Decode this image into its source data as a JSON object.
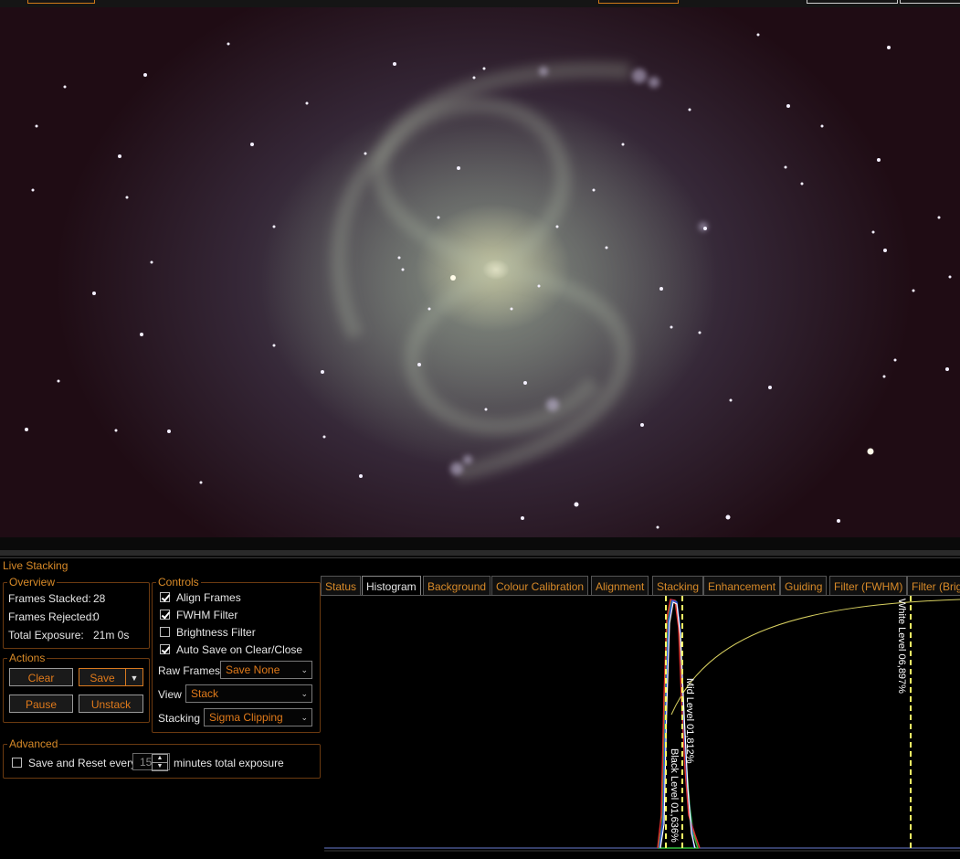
{
  "window": {
    "panel_title": "Live Stacking"
  },
  "overview": {
    "legend": "Overview",
    "frames_stacked_label": "Frames Stacked:",
    "frames_stacked_value": "28",
    "frames_rejected_label": "Frames Rejected:",
    "frames_rejected_value": "0",
    "total_exposure_label": "Total Exposure:",
    "total_exposure_value": "21m 0s"
  },
  "actions": {
    "legend": "Actions",
    "clear": "Clear",
    "save": "Save",
    "pause": "Pause",
    "unstack": "Unstack"
  },
  "controls": {
    "legend": "Controls",
    "align_frames": {
      "label": "Align Frames",
      "checked": true
    },
    "fwhm_filter": {
      "label": "FWHM Filter",
      "checked": true
    },
    "brightness_filter": {
      "label": "Brightness Filter",
      "checked": false
    },
    "auto_save": {
      "label": "Auto Save on Clear/Close",
      "checked": true
    },
    "raw_frames_label": "Raw Frames",
    "raw_frames_value": "Save None",
    "view_label": "View",
    "view_value": "Stack",
    "stacking_label": "Stacking",
    "stacking_value": "Sigma Clipping"
  },
  "advanced": {
    "legend": "Advanced",
    "save_reset_label": "Save and Reset every",
    "minutes_value": "15",
    "minutes_suffix": "minutes total exposure",
    "checked": false
  },
  "tabs": [
    "Status",
    "Histogram",
    "Background",
    "Colour Calibration",
    "Alignment",
    "Stacking",
    "Enhancement",
    "Guiding",
    "Filter (FWHM)",
    "Filter (Brig"
  ],
  "active_tab": "Histogram",
  "histogram": {
    "black_level": "Black Level 01,636%",
    "mid_level": "Mid Level 01,812%",
    "white_level": "White Level 06,897%",
    "marker_color": "#ffff66",
    "curve_color": "#d8d060"
  }
}
